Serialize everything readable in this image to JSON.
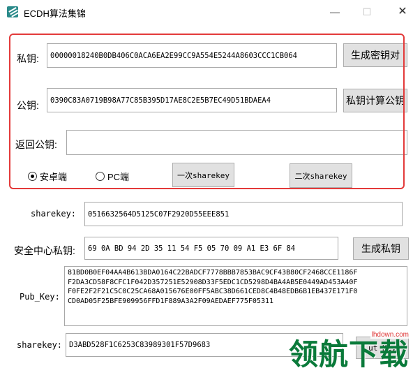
{
  "window": {
    "title": "ECDH算法集锦",
    "minimize": "—",
    "maximize": "☐",
    "close": "✕"
  },
  "private_key": {
    "label": "私钥:",
    "value": "00000018240B0DB406C0ACA6EA2E99CC9A554E5244A8603CCC1CB064",
    "button": "生成密钥对"
  },
  "public_key": {
    "label": "公钥:",
    "value": "0390C83A0719B98A77C85B395D17AE8C2E5B7EC49D51BDAEA4",
    "button": "私钥计算公钥"
  },
  "returned_public_key": {
    "label": "返回公钥:",
    "value": ""
  },
  "platform": {
    "options": [
      {
        "label": "安卓端",
        "selected": true
      },
      {
        "label": "PC端",
        "selected": false
      }
    ]
  },
  "share_buttons": {
    "first": "一次sharekey",
    "second": "二次sharekey"
  },
  "sharekey_1": {
    "label": "sharekey:",
    "value": "0516632564D5125C07F2920D55EEE851"
  },
  "center_private_key": {
    "label": "安全中心私钥:",
    "value": "69 0A BD 94 2D 35 11 54 F5 05 70 09 A1 E3 6F 84",
    "button": "生成私钥"
  },
  "pub_key": {
    "label": "Pub_Key:",
    "lines": [
      "81BD0B0EF04AA4B613BDA0164C22BADCF7778BBB7853BAC9CF43B80CF2468CCE1186F",
      "F2DA3CD58F8CFC1F042D357251E52908D33F5EDC1CD5298D4BA4AB5E0449AD453A40F",
      "F0FE2F2F21C5C0C25CA68A015676E00FF5ABC38D661CED8C4B48EDB6B1EB437E171F0",
      "CD0AD05F25BFE909956FFD1F889A3A2F09AEDAEF775F05311"
    ]
  },
  "sharekey_2": {
    "label": "sharekey:",
    "value": "D3ABD528F1C6253C83989301F57D9683",
    "button": "ut Key"
  },
  "watermark": {
    "text": "领航下载",
    "url": "lhdown.com"
  }
}
